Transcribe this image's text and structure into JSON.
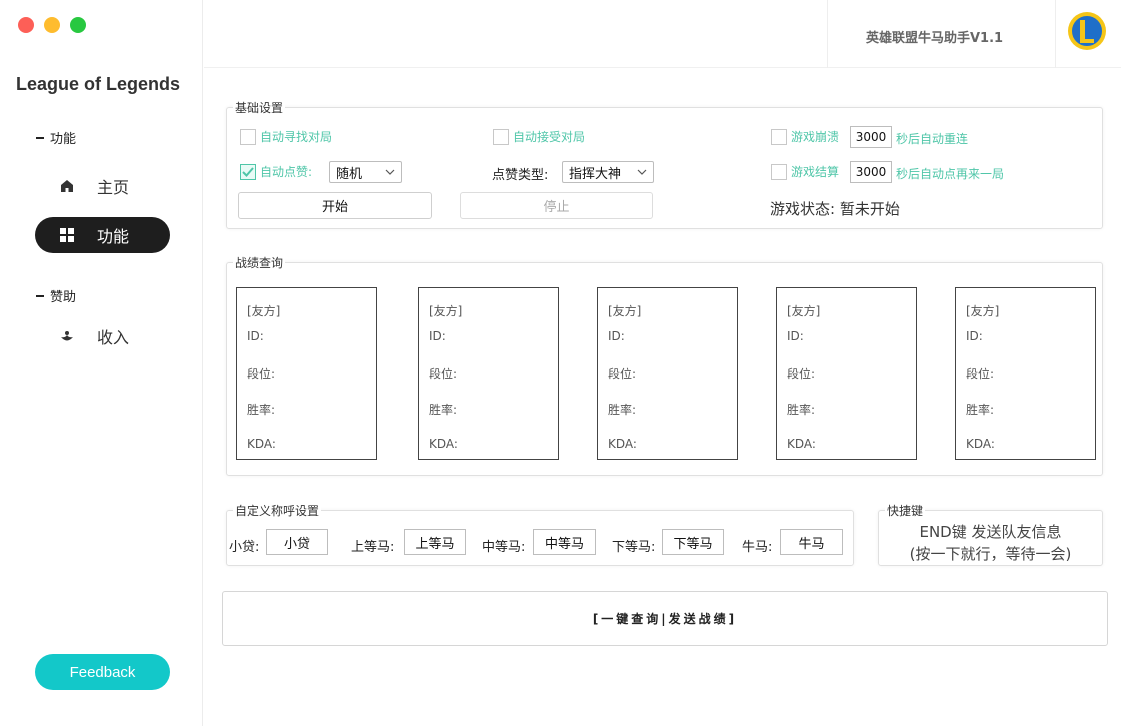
{
  "window": {
    "traffic_lights": [
      "close",
      "minimize",
      "zoom"
    ]
  },
  "sidebar": {
    "app_name": "League of Legends",
    "section_function": "功能",
    "section_sponsor": "赞助",
    "items": [
      {
        "label": "主页",
        "icon": "home-icon"
      },
      {
        "label": "功能",
        "icon": "grid-icon",
        "active": true
      },
      {
        "label": "收入",
        "icon": "income-icon"
      }
    ],
    "feedback_label": "Feedback"
  },
  "header": {
    "title": "英雄联盟牛马助手V1.1",
    "logo_icon": "league-logo-icon"
  },
  "basic": {
    "title": "基础设置",
    "auto_find": "自动寻找对局",
    "auto_accept": "自动接受对局",
    "crash_prefix": "游戏崩溃",
    "crash_value": "3000",
    "crash_suffix": "秒后自动重连",
    "auto_like": "自动点赞:",
    "like_select": "随机",
    "like_type_label": "点赞类型:",
    "like_type_select": "指挥大神",
    "end_prefix": "游戏结算",
    "end_value": "3000",
    "end_suffix": "秒后自动点再来一局",
    "start_label": "开始",
    "stop_label": "停止",
    "status_label": "游戏状态:",
    "status_value": "暂未开始"
  },
  "records": {
    "title": "战绩查询",
    "cards": [
      {
        "side": "[友方]",
        "id": "ID:",
        "rank": "段位:",
        "winrate": "胜率:",
        "kda": "KDA:"
      },
      {
        "side": "[友方]",
        "id": "ID:",
        "rank": "段位:",
        "winrate": "胜率:",
        "kda": "KDA:"
      },
      {
        "side": "[友方]",
        "id": "ID:",
        "rank": "段位:",
        "winrate": "胜率:",
        "kda": "KDA:"
      },
      {
        "side": "[友方]",
        "id": "ID:",
        "rank": "段位:",
        "winrate": "胜率:",
        "kda": "KDA:"
      },
      {
        "side": "[友方]",
        "id": "ID:",
        "rank": "段位:",
        "winrate": "胜率:",
        "kda": "KDA:"
      }
    ]
  },
  "names": {
    "title": "自定义称呼设置",
    "fields": [
      {
        "label": "小贷:",
        "value": "小贷"
      },
      {
        "label": "上等马:",
        "value": "上等马"
      },
      {
        "label": "中等马:",
        "value": "中等马"
      },
      {
        "label": "下等马:",
        "value": "下等马"
      },
      {
        "label": "牛马:",
        "value": "牛马"
      }
    ]
  },
  "hotkey": {
    "title": "快捷键",
    "line1": "END键 发送队友信息",
    "line2": "(按一下就行，等待一会)"
  },
  "action": {
    "label": "[一键查询|发送战绩]"
  },
  "colors": {
    "accent": "#13c8c9",
    "checkbox": "#4fc6a8",
    "active_nav": "#1e1e1e"
  }
}
